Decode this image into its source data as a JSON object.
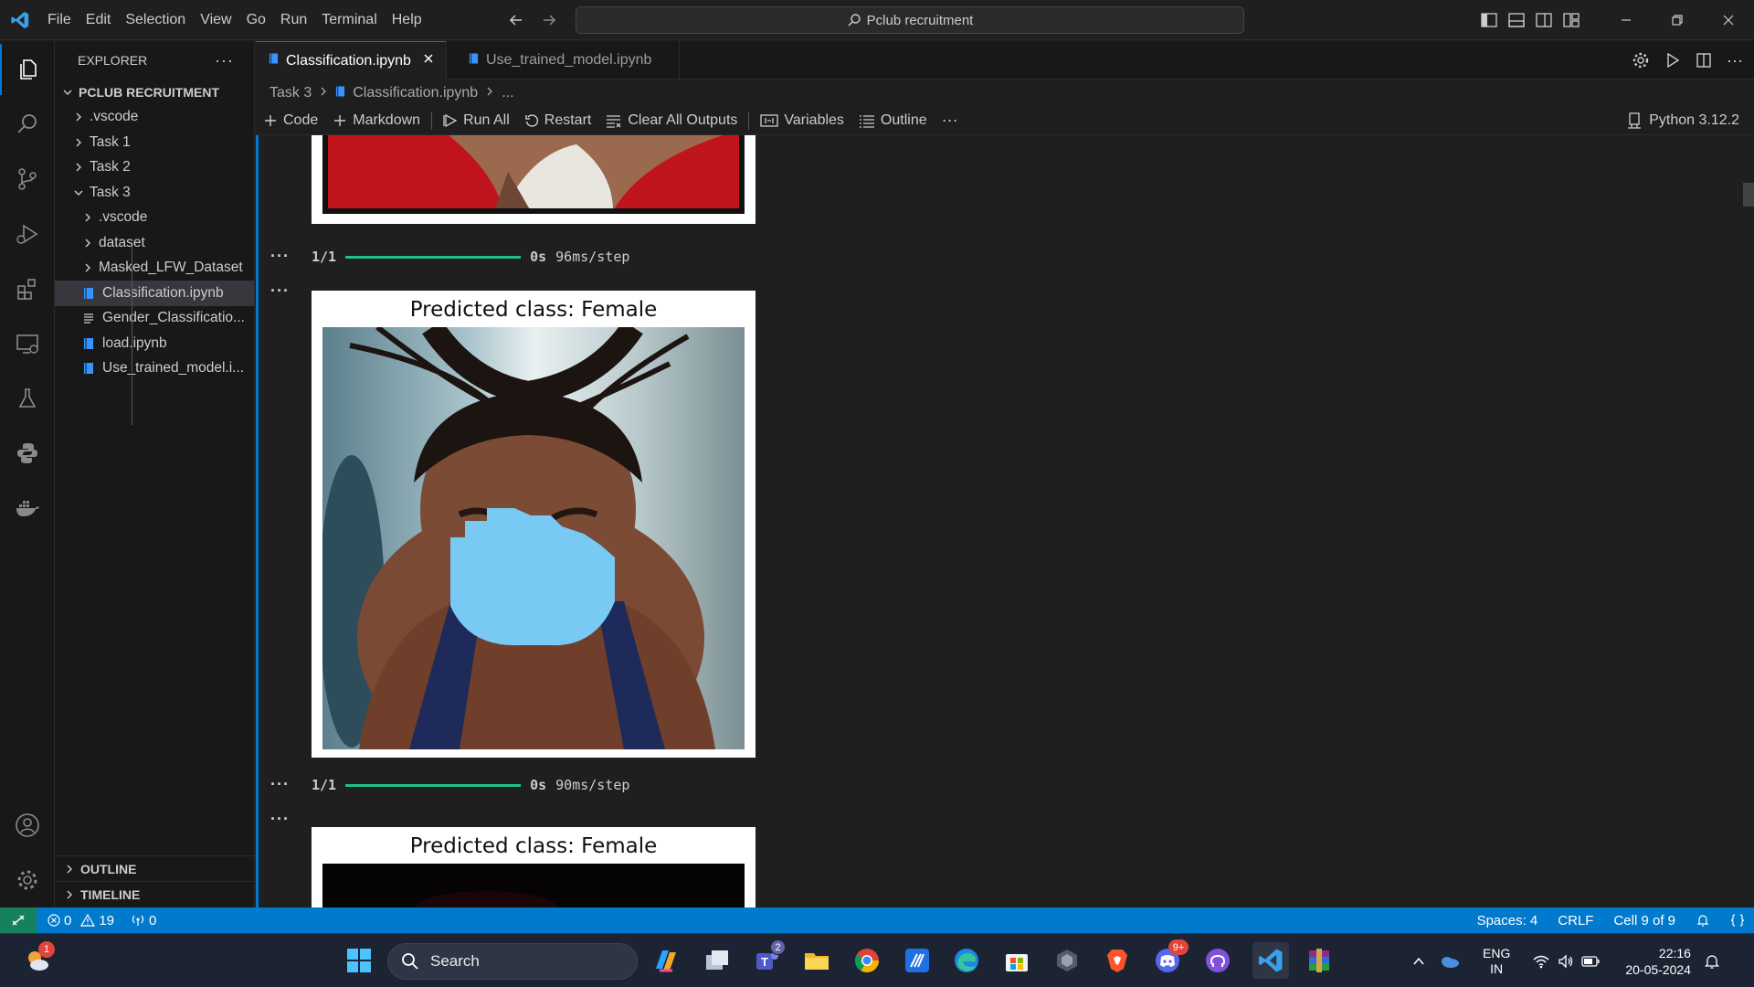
{
  "titlebar": {
    "menu": [
      "File",
      "Edit",
      "Selection",
      "View",
      "Go",
      "Run",
      "Terminal",
      "Help"
    ],
    "search_text": "Pclub recruitment"
  },
  "explorer": {
    "title": "EXPLORER",
    "root": "PCLUB RECRUITMENT",
    "items": [
      {
        "label": ".vscode",
        "type": "folder",
        "expanded": false,
        "depth": 1
      },
      {
        "label": "Task 1",
        "type": "folder",
        "expanded": false,
        "depth": 1
      },
      {
        "label": "Task 2",
        "type": "folder",
        "expanded": false,
        "depth": 1
      },
      {
        "label": "Task 3",
        "type": "folder",
        "expanded": true,
        "depth": 1
      },
      {
        "label": ".vscode",
        "type": "folder",
        "expanded": false,
        "depth": 2
      },
      {
        "label": "dataset",
        "type": "folder",
        "expanded": false,
        "depth": 2
      },
      {
        "label": "Masked_LFW_Dataset",
        "type": "folder",
        "expanded": false,
        "depth": 2
      },
      {
        "label": "Classification.ipynb",
        "type": "notebook",
        "selected": true,
        "depth": 2
      },
      {
        "label": "Gender_Classificatio...",
        "type": "text",
        "depth": 2
      },
      {
        "label": "load.ipynb",
        "type": "notebook",
        "depth": 2
      },
      {
        "label": "Use_trained_model.i...",
        "type": "notebook",
        "depth": 2
      }
    ],
    "outline": "OUTLINE",
    "timeline": "TIMELINE"
  },
  "tabs": [
    {
      "label": "Classification.ipynb",
      "active": true
    },
    {
      "label": "Use_trained_model.ipynb",
      "active": false
    }
  ],
  "breadcrumb": {
    "folder": "Task 3",
    "file": "Classification.ipynb",
    "more": "..."
  },
  "toolbar": {
    "code": "Code",
    "markdown": "Markdown",
    "run_all": "Run All",
    "restart": "Restart",
    "clear": "Clear All Outputs",
    "variables": "Variables",
    "outline": "Outline",
    "kernel": "Python 3.12.2"
  },
  "outputs": [
    {
      "step_count": "1/1",
      "time": "0s",
      "speed": "96ms/step"
    },
    {
      "title": "Predicted class: Female"
    },
    {
      "step_count": "1/1",
      "time": "0s",
      "speed": "90ms/step"
    },
    {
      "title": "Predicted class: Female"
    }
  ],
  "status": {
    "errors": "0",
    "warnings": "19",
    "ports": "0",
    "spaces": "Spaces: 4",
    "eol": "CRLF",
    "cell": "Cell 9 of 9"
  },
  "taskbar": {
    "search": "Search",
    "lang_top": "ENG",
    "lang_bottom": "IN",
    "time": "22:16",
    "date": "20-05-2024",
    "weather_badge": "1",
    "teams_badge": "2",
    "discord_badge": "9+"
  },
  "colors": {
    "accent": "#0078d4",
    "statusbar": "#007acc",
    "mask": "#79c9f5",
    "progress": "#1fbf8f"
  }
}
